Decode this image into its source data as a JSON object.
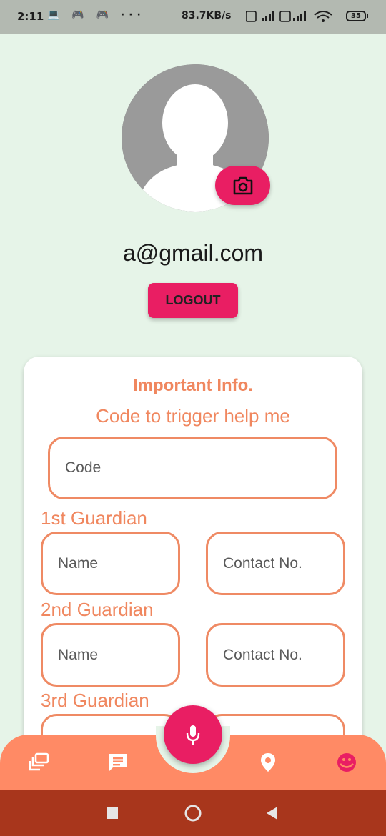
{
  "status_bar": {
    "time": "2:11",
    "left_icons": "💻 🎮 🎮 ···",
    "network_speed": "83.7KB/s",
    "right_icons": "VoLTE 4G VoLTE",
    "battery": "35"
  },
  "profile": {
    "email": "a@gmail.com",
    "logout_label": "LOGOUT",
    "camera_icon": "camera-icon",
    "avatar_icon": "person-silhouette"
  },
  "card": {
    "title": "Important Info.",
    "subtitle": "Code to trigger help me",
    "code_placeholder": "Code",
    "guardians": [
      {
        "label": "1st Guardian",
        "name_placeholder": "Name",
        "contact_placeholder": "Contact No."
      },
      {
        "label": "2nd Guardian",
        "name_placeholder": "Name",
        "contact_placeholder": "Contact No."
      },
      {
        "label": "3rd Guardian",
        "name_placeholder": "",
        "contact_placeholder": ""
      }
    ]
  },
  "bottom_nav": {
    "items": [
      "gallery-icon",
      "chat-icon",
      "mic-icon",
      "location-pin-icon",
      "profile-icon"
    ],
    "bar_color": "#ff8a65",
    "accent_color": "#e91e63"
  },
  "system_nav": {
    "items": [
      "recents-square-icon",
      "home-circle-icon",
      "back-triangle-icon"
    ],
    "bar_color": "#a8361c"
  }
}
